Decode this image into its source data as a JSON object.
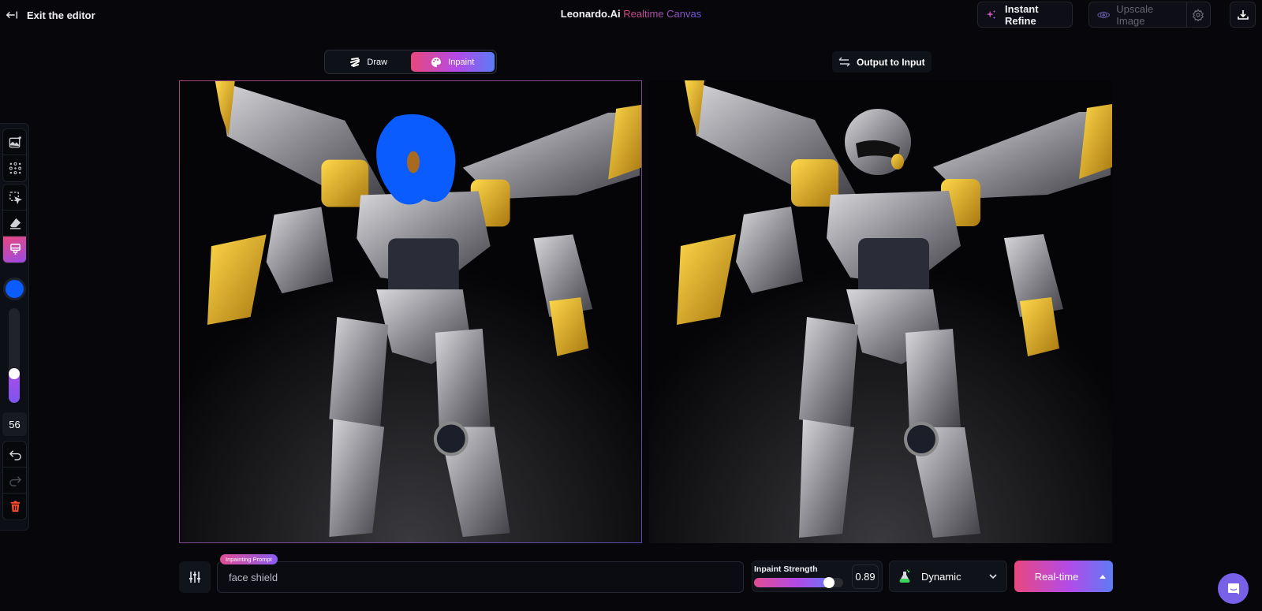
{
  "header": {
    "exit_label": "Exit the editor",
    "brand": "Leonardo.Ai",
    "subtitle": "Realtime Canvas",
    "instant_refine_label": "Instant Refine",
    "upscale_label": "Upscale Image"
  },
  "mode_toggle": {
    "options": [
      {
        "label": "Draw",
        "active": false
      },
      {
        "label": "Inpaint",
        "active": true
      }
    ]
  },
  "output_to_input_label": "Output to Input",
  "toolbar": {
    "tools": [
      "add-image",
      "pattern",
      "select",
      "eraser",
      "paint-brush"
    ],
    "active_tool": "paint-brush",
    "brush_color": "#0a5cff",
    "brush_size": "56",
    "brush_size_fraction": 0.28
  },
  "prompt": {
    "badge": "Inpainting Prompt",
    "value": "face shield",
    "placeholder": ""
  },
  "inpaint_strength": {
    "label": "Inpaint Strength",
    "value": "0.89",
    "fraction": 0.89
  },
  "style": {
    "selected": "Dynamic"
  },
  "generate": {
    "label": "Real-time"
  },
  "colors": {
    "accent_pink": "#e8487e",
    "accent_purple": "#b34ae8",
    "accent_blue": "#5f7cf5",
    "mask_blue": "#0a5cff"
  }
}
